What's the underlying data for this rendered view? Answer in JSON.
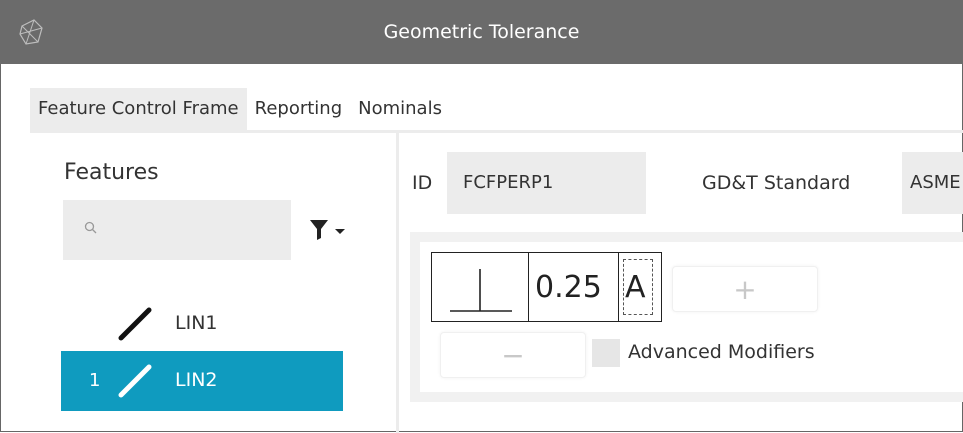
{
  "window": {
    "title": "Geometric Tolerance",
    "logo_icon": "app-logo-icon"
  },
  "tabs": [
    {
      "label": "Feature Control Frame",
      "active": true
    },
    {
      "label": "Reporting",
      "active": false
    },
    {
      "label": "Nominals",
      "active": false
    }
  ],
  "features": {
    "title": "Features",
    "search": {
      "placeholder": "",
      "value": "",
      "icon": "search-icon"
    },
    "filter_icon": "filter-icon",
    "items": [
      {
        "index": "",
        "name": "LIN1",
        "icon": "line-icon",
        "selected": false
      },
      {
        "index": "1",
        "name": "LIN2",
        "icon": "line-icon",
        "selected": true
      }
    ]
  },
  "form": {
    "id_label": "ID",
    "id_value": "FCFPERP1",
    "standard_label": "GD&T Standard",
    "standard_value": "ASME"
  },
  "fcf": {
    "symbol_icon": "perpendicularity-icon",
    "tolerance": "0.25",
    "datum": "A",
    "add_label": "+",
    "remove_label": "−",
    "advanced_modifiers_label": "Advanced Modifiers",
    "advanced_modifiers_checked": false
  },
  "colors": {
    "titlebar": "#6b6b6b",
    "selection": "#0f9bbf",
    "panel_bg": "#ececec"
  }
}
